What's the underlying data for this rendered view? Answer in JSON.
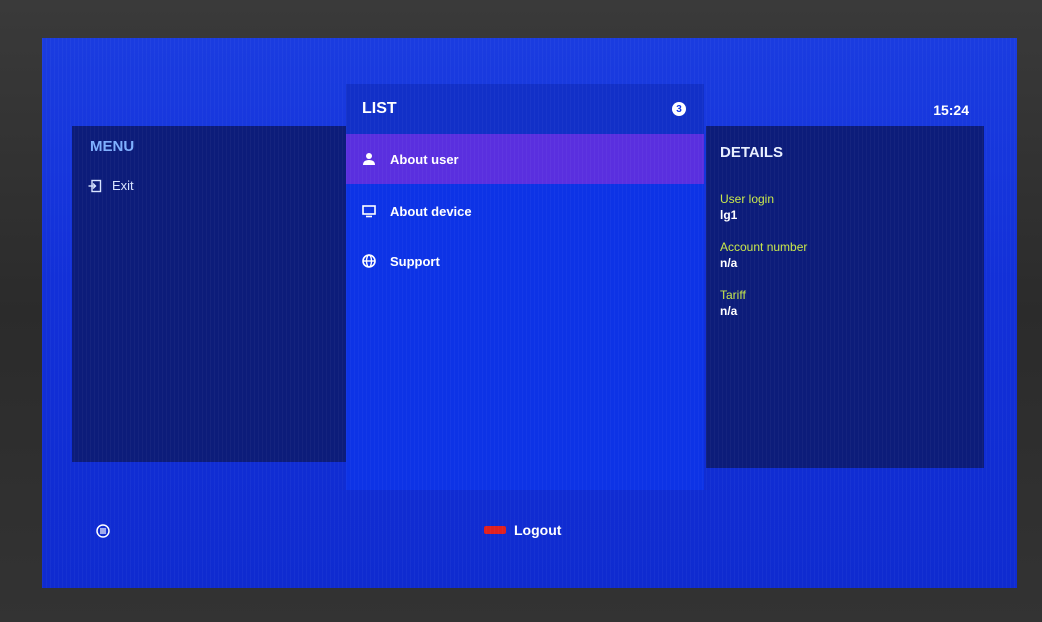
{
  "clock": "15:24",
  "menu": {
    "title": "MENU",
    "items": [
      {
        "label": "Exit",
        "icon": "exit-icon"
      }
    ]
  },
  "list": {
    "title": "LIST",
    "count": "3",
    "items": [
      {
        "label": "About user",
        "icon": "user-icon",
        "selected": true
      },
      {
        "label": "About device",
        "icon": "monitor-icon",
        "selected": false
      },
      {
        "label": "Support",
        "icon": "globe-icon",
        "selected": false
      }
    ]
  },
  "details": {
    "title": "DETAILS",
    "fields": [
      {
        "label": "User login",
        "value": "lg1"
      },
      {
        "label": "Account number",
        "value": "n/a"
      },
      {
        "label": "Tariff",
        "value": "n/a"
      }
    ]
  },
  "footer": {
    "logout_label": "Logout",
    "logout_key_color": "#e02020",
    "left_icon": "menu-key-icon"
  },
  "colors": {
    "screen_bg": "#1230d8",
    "side_panel_bg": "#0c1c7a",
    "list_bg": "#0d33e6",
    "selected_bg": "#5a2fdf",
    "label_color": "#c9e84a"
  }
}
